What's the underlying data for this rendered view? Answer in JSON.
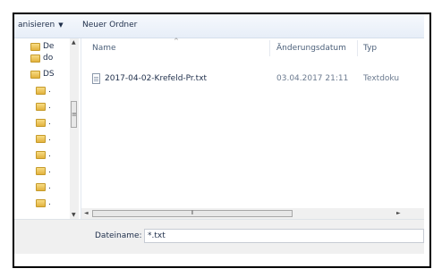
{
  "toolbar": {
    "organize_label": "anisieren",
    "new_folder_label": "Neuer Ordner"
  },
  "tree": {
    "items": [
      {
        "label": "De",
        "icon": "folder-icon"
      },
      {
        "label": "do",
        "icon": "folder-icon"
      },
      {
        "label": "DS",
        "icon": "folder-icon"
      },
      {
        "label": ".",
        "icon": "folder-icon"
      },
      {
        "label": ".",
        "icon": "folder-icon"
      },
      {
        "label": ".",
        "icon": "folder-icon"
      },
      {
        "label": ".",
        "icon": "folder-icon"
      },
      {
        "label": ".",
        "icon": "folder-icon"
      },
      {
        "label": ".",
        "icon": "folder-icon"
      },
      {
        "label": ".",
        "icon": "folder-icon"
      },
      {
        "label": ".",
        "icon": "folder-icon"
      }
    ]
  },
  "columns": {
    "name": "Name",
    "date": "Änderungsdatum",
    "type": "Typ"
  },
  "files": [
    {
      "name": "2017-04-02-Krefeld-Pr.txt",
      "date": "03.04.2017 21:11",
      "type": "Textdoku"
    }
  ],
  "filename": {
    "label": "Dateiname:",
    "value": "*.txt"
  },
  "colors": {
    "toolbar_bg": "#e7eef8",
    "folder": "#e2b23e",
    "text": "#1e2e4a"
  }
}
